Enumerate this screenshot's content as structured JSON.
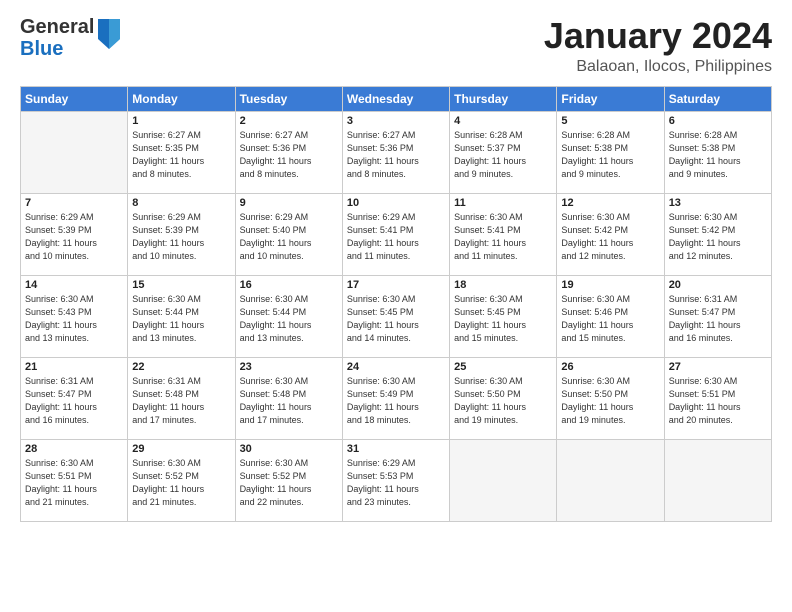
{
  "logo": {
    "general": "General",
    "blue": "Blue"
  },
  "title": "January 2024",
  "subtitle": "Balaoan, Ilocos, Philippines",
  "headers": [
    "Sunday",
    "Monday",
    "Tuesday",
    "Wednesday",
    "Thursday",
    "Friday",
    "Saturday"
  ],
  "weeks": [
    [
      {
        "num": "",
        "sunrise": "",
        "sunset": "",
        "daylight": ""
      },
      {
        "num": "1",
        "sunrise": "6:27 AM",
        "sunset": "5:35 PM",
        "daylight": "11 hours and 8 minutes."
      },
      {
        "num": "2",
        "sunrise": "6:27 AM",
        "sunset": "5:36 PM",
        "daylight": "11 hours and 8 minutes."
      },
      {
        "num": "3",
        "sunrise": "6:27 AM",
        "sunset": "5:36 PM",
        "daylight": "11 hours and 8 minutes."
      },
      {
        "num": "4",
        "sunrise": "6:28 AM",
        "sunset": "5:37 PM",
        "daylight": "11 hours and 9 minutes."
      },
      {
        "num": "5",
        "sunrise": "6:28 AM",
        "sunset": "5:38 PM",
        "daylight": "11 hours and 9 minutes."
      },
      {
        "num": "6",
        "sunrise": "6:28 AM",
        "sunset": "5:38 PM",
        "daylight": "11 hours and 9 minutes."
      }
    ],
    [
      {
        "num": "7",
        "sunrise": "6:29 AM",
        "sunset": "5:39 PM",
        "daylight": "11 hours and 10 minutes."
      },
      {
        "num": "8",
        "sunrise": "6:29 AM",
        "sunset": "5:39 PM",
        "daylight": "11 hours and 10 minutes."
      },
      {
        "num": "9",
        "sunrise": "6:29 AM",
        "sunset": "5:40 PM",
        "daylight": "11 hours and 10 minutes."
      },
      {
        "num": "10",
        "sunrise": "6:29 AM",
        "sunset": "5:41 PM",
        "daylight": "11 hours and 11 minutes."
      },
      {
        "num": "11",
        "sunrise": "6:30 AM",
        "sunset": "5:41 PM",
        "daylight": "11 hours and 11 minutes."
      },
      {
        "num": "12",
        "sunrise": "6:30 AM",
        "sunset": "5:42 PM",
        "daylight": "11 hours and 12 minutes."
      },
      {
        "num": "13",
        "sunrise": "6:30 AM",
        "sunset": "5:42 PM",
        "daylight": "11 hours and 12 minutes."
      }
    ],
    [
      {
        "num": "14",
        "sunrise": "6:30 AM",
        "sunset": "5:43 PM",
        "daylight": "11 hours and 13 minutes."
      },
      {
        "num": "15",
        "sunrise": "6:30 AM",
        "sunset": "5:44 PM",
        "daylight": "11 hours and 13 minutes."
      },
      {
        "num": "16",
        "sunrise": "6:30 AM",
        "sunset": "5:44 PM",
        "daylight": "11 hours and 13 minutes."
      },
      {
        "num": "17",
        "sunrise": "6:30 AM",
        "sunset": "5:45 PM",
        "daylight": "11 hours and 14 minutes."
      },
      {
        "num": "18",
        "sunrise": "6:30 AM",
        "sunset": "5:45 PM",
        "daylight": "11 hours and 15 minutes."
      },
      {
        "num": "19",
        "sunrise": "6:30 AM",
        "sunset": "5:46 PM",
        "daylight": "11 hours and 15 minutes."
      },
      {
        "num": "20",
        "sunrise": "6:31 AM",
        "sunset": "5:47 PM",
        "daylight": "11 hours and 16 minutes."
      }
    ],
    [
      {
        "num": "21",
        "sunrise": "6:31 AM",
        "sunset": "5:47 PM",
        "daylight": "11 hours and 16 minutes."
      },
      {
        "num": "22",
        "sunrise": "6:31 AM",
        "sunset": "5:48 PM",
        "daylight": "11 hours and 17 minutes."
      },
      {
        "num": "23",
        "sunrise": "6:30 AM",
        "sunset": "5:48 PM",
        "daylight": "11 hours and 17 minutes."
      },
      {
        "num": "24",
        "sunrise": "6:30 AM",
        "sunset": "5:49 PM",
        "daylight": "11 hours and 18 minutes."
      },
      {
        "num": "25",
        "sunrise": "6:30 AM",
        "sunset": "5:50 PM",
        "daylight": "11 hours and 19 minutes."
      },
      {
        "num": "26",
        "sunrise": "6:30 AM",
        "sunset": "5:50 PM",
        "daylight": "11 hours and 19 minutes."
      },
      {
        "num": "27",
        "sunrise": "6:30 AM",
        "sunset": "5:51 PM",
        "daylight": "11 hours and 20 minutes."
      }
    ],
    [
      {
        "num": "28",
        "sunrise": "6:30 AM",
        "sunset": "5:51 PM",
        "daylight": "11 hours and 21 minutes."
      },
      {
        "num": "29",
        "sunrise": "6:30 AM",
        "sunset": "5:52 PM",
        "daylight": "11 hours and 21 minutes."
      },
      {
        "num": "30",
        "sunrise": "6:30 AM",
        "sunset": "5:52 PM",
        "daylight": "11 hours and 22 minutes."
      },
      {
        "num": "31",
        "sunrise": "6:29 AM",
        "sunset": "5:53 PM",
        "daylight": "11 hours and 23 minutes."
      },
      {
        "num": "",
        "sunrise": "",
        "sunset": "",
        "daylight": ""
      },
      {
        "num": "",
        "sunrise": "",
        "sunset": "",
        "daylight": ""
      },
      {
        "num": "",
        "sunrise": "",
        "sunset": "",
        "daylight": ""
      }
    ]
  ]
}
